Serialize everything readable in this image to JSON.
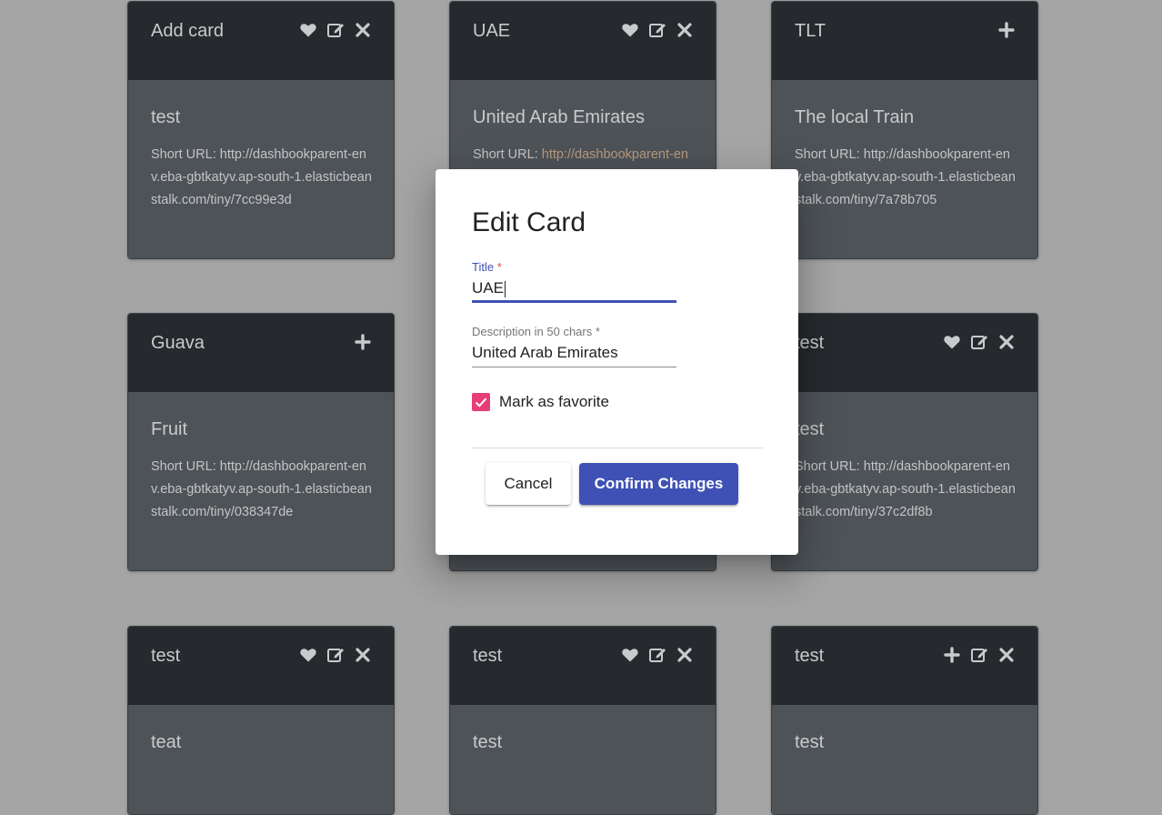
{
  "cards": [
    {
      "title": "Add card",
      "icons": [
        "heart-icon",
        "edit-icon",
        "close-icon"
      ],
      "subtitle": "test",
      "url_label": "Short URL: ",
      "url": "http://dashbookparent-env.eba-gbtkatyv.ap-south-1.elasticbeanstalk.com/tiny/7cc99e3d"
    },
    {
      "title": "UAE",
      "icons": [
        "heart-icon",
        "edit-icon",
        "close-icon"
      ],
      "subtitle": "United Arab Emirates",
      "url_label": "Short URL: ",
      "url": "http://dashbookparent-env.eba-gbtkatyv.ap-south-1.elasticbeanstalk.com/tiny/"
    },
    {
      "title": "TLT",
      "icons": [
        "plus-icon"
      ],
      "subtitle": "The local Train",
      "url_label": "Short URL: ",
      "url": "http://dashbookparent-env.eba-gbtkatyv.ap-south-1.elasticbeanstalk.com/tiny/7a78b705"
    },
    {
      "title": "Guava",
      "icons": [
        "plus-icon"
      ],
      "subtitle": "Fruit",
      "url_label": "Short URL: ",
      "url": "http://dashbookparent-env.eba-gbtkatyv.ap-south-1.elasticbeanstalk.com/tiny/038347de"
    },
    {
      "title": "",
      "icons": [],
      "subtitle": "",
      "url_label": "",
      "url": ""
    },
    {
      "title": "test",
      "icons": [
        "heart-icon",
        "edit-icon",
        "close-icon"
      ],
      "subtitle": "test",
      "url_label": "Short URL: ",
      "url": "http://dashbookparent-env.eba-gbtkatyv.ap-south-1.elasticbeanstalk.com/tiny/37c2df8b"
    },
    {
      "title": "test",
      "icons": [
        "heart-icon",
        "edit-icon",
        "close-icon"
      ],
      "subtitle": "teat",
      "url_label": "",
      "url": ""
    },
    {
      "title": "test",
      "icons": [
        "heart-icon",
        "edit-icon",
        "close-icon"
      ],
      "subtitle": "test",
      "url_label": "",
      "url": ""
    },
    {
      "title": "test",
      "icons": [
        "plus-icon",
        "edit-icon",
        "close-icon"
      ],
      "subtitle": "test",
      "url_label": "",
      "url": ""
    }
  ],
  "dialog": {
    "title": "Edit Card",
    "title_field": {
      "label": "Title",
      "required_mark": "*",
      "value": "UAE"
    },
    "description_field": {
      "label": "Description in 50 chars *",
      "value": "United Arab Emirates"
    },
    "favorite": {
      "label": "Mark as favorite",
      "checked": true
    },
    "cancel_label": "Cancel",
    "confirm_label": "Confirm Changes"
  },
  "colors": {
    "accent": "#3f51b5",
    "checkbox": "#e83e77",
    "card_head": "#26292d",
    "card_body": "#4e5358"
  }
}
